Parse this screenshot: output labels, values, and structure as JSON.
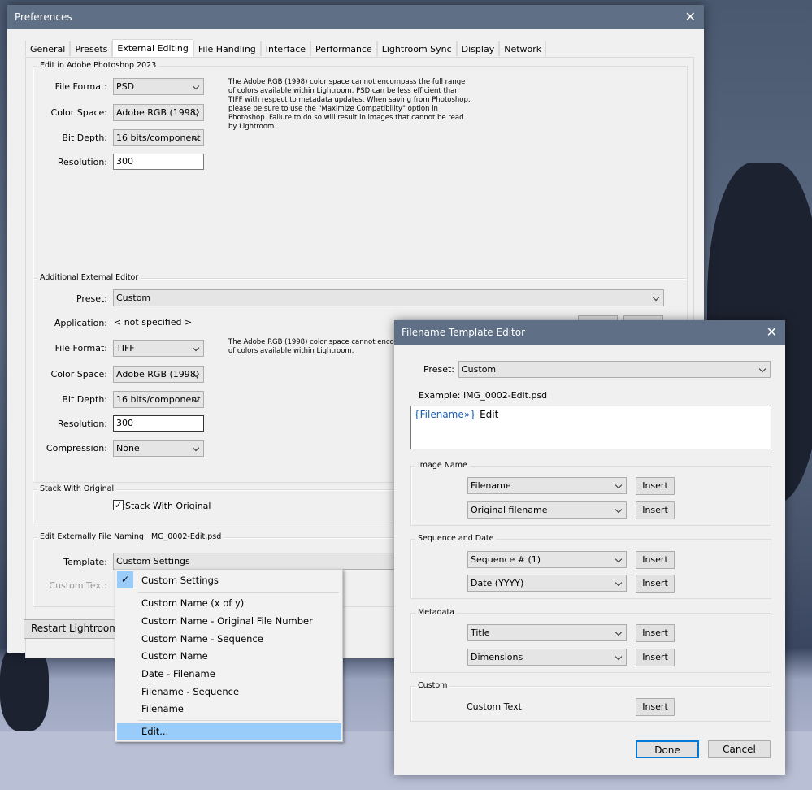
{
  "preferences": {
    "title": "Preferences",
    "tabs": [
      "General",
      "Presets",
      "External Editing",
      "File Handling",
      "Interface",
      "Performance",
      "Lightroom Sync",
      "Display",
      "Network"
    ],
    "active_tab": "External Editing",
    "photoshop": {
      "group_title": "Edit in Adobe Photoshop 2023",
      "file_format_label": "File Format:",
      "file_format": "PSD",
      "color_space_label": "Color Space:",
      "color_space": "Adobe RGB (1998)",
      "bit_depth_label": "Bit Depth:",
      "bit_depth": "16 bits/component",
      "resolution_label": "Resolution:",
      "resolution": "300",
      "note": "The Adobe RGB (1998) color space cannot encompass the full range of colors available within Lightroom. PSD can be less efficient than TIFF with respect to metadata updates. When saving from Photoshop, please be sure to use the \"Maximize Compatibility\" option in Photoshop. Failure to do so will result in images that cannot be read by Lightroom."
    },
    "additional": {
      "group_title": "Additional External Editor",
      "preset_label": "Preset:",
      "preset": "Custom",
      "application_label": "Application:",
      "application": "< not specified >",
      "file_format_label": "File Format:",
      "file_format": "TIFF",
      "color_space_label": "Color Space:",
      "color_space": "Adobe RGB (1998)",
      "bit_depth_label": "Bit Depth:",
      "bit_depth": "16 bits/component",
      "resolution_label": "Resolution:",
      "resolution": "300",
      "compression_label": "Compression:",
      "compression": "None",
      "note": "The Adobe RGB (1998) color space cannot encompass the full range of colors available within Lightroom."
    },
    "stack": {
      "group_title": "Stack With Original",
      "checkbox_label": "Stack With Original",
      "checked": true
    },
    "naming": {
      "group_title": "Edit Externally File Naming:",
      "example": "IMG_0002-Edit.psd",
      "template_label": "Template:",
      "template": "Custom Settings",
      "custom_text_label": "Custom Text:"
    },
    "restart_button": "Restart Lightroom",
    "template_menu": {
      "items": [
        "Custom Settings",
        "Custom Name (x of y)",
        "Custom Name - Original File Number",
        "Custom Name - Sequence",
        "Custom Name",
        "Date - Filename",
        "Filename - Sequence",
        "Filename",
        "Edit..."
      ],
      "checked": "Custom Settings",
      "highlighted": "Edit..."
    }
  },
  "editor": {
    "title": "Filename Template Editor",
    "preset_label": "Preset:",
    "preset": "Custom",
    "example_label": "Example:",
    "example": "IMG_0002-Edit.psd",
    "token": "{Filename»}",
    "token_suffix": "-Edit",
    "image_name": {
      "title": "Image Name",
      "field1": "Filename",
      "field2": "Original filename"
    },
    "sequence": {
      "title": "Sequence and Date",
      "field1": "Sequence # (1)",
      "field2": "Date (YYYY)"
    },
    "metadata": {
      "title": "Metadata",
      "field1": "Title",
      "field2": "Dimensions"
    },
    "custom": {
      "title": "Custom",
      "label": "Custom Text"
    },
    "insert": "Insert",
    "done": "Done",
    "cancel": "Cancel"
  },
  "colors": {
    "titlebar": "#5f6f86",
    "menu_highlight": "#99ccf8",
    "token": "#1a5fb4"
  }
}
